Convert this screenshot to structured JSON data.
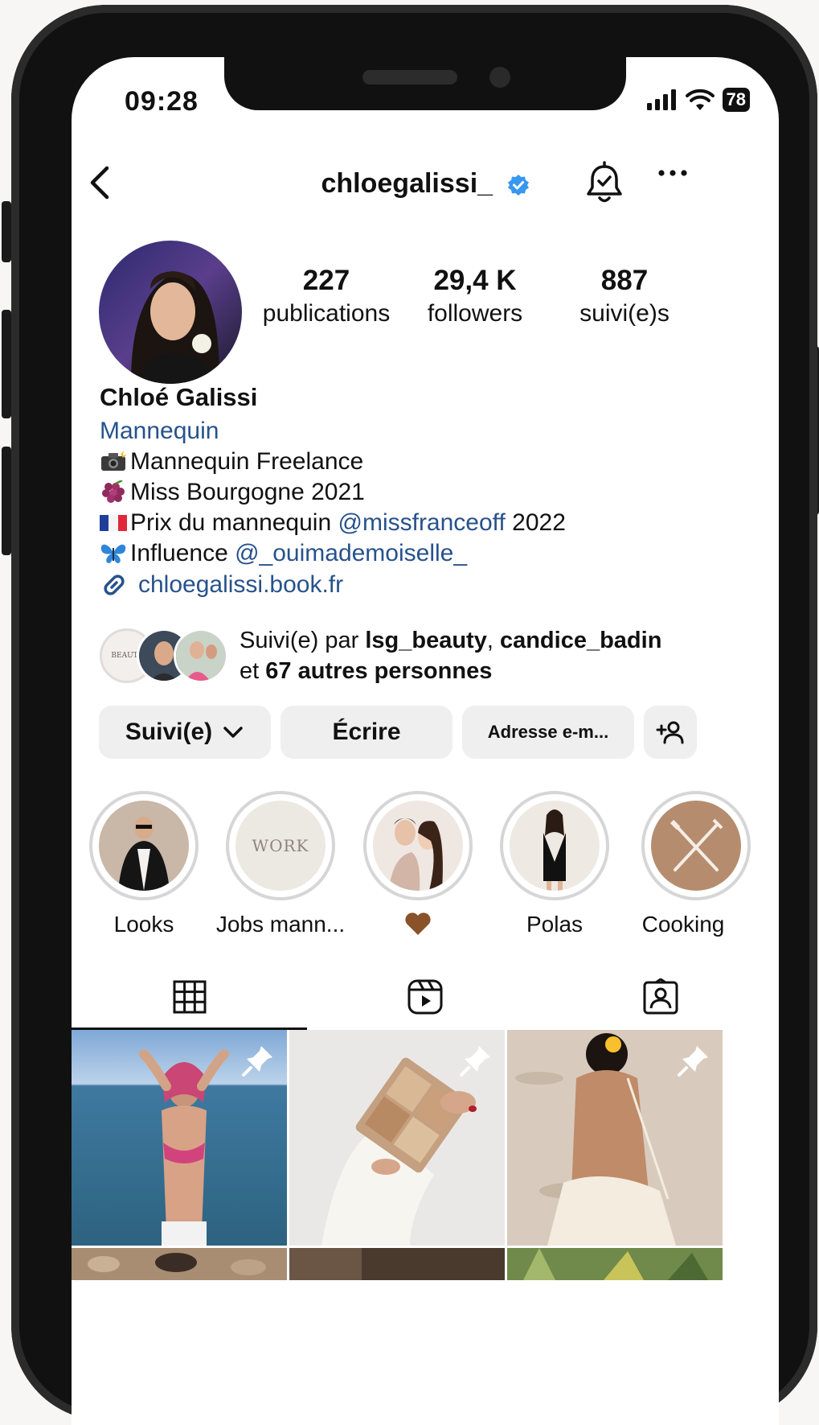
{
  "status_bar": {
    "time": "09:28",
    "battery": "78"
  },
  "header": {
    "username": "chloegalissi_"
  },
  "stats": [
    {
      "number": "227",
      "label": "publications"
    },
    {
      "number": "29,4 K",
      "label": "followers"
    },
    {
      "number": "887",
      "label": "suivi(e)s"
    }
  ],
  "bio": {
    "name": "Chloé Galissi",
    "category": "Mannequin",
    "line1": "Mannequin Freelance",
    "line2": "Miss Bourgogne 2021",
    "line3_prefix": "Prix du mannequin ",
    "line3_mention": "@missfranceoff",
    "line3_suffix": " 2022",
    "line4_prefix": "Influence ",
    "line4_mention": "@_ouimademoiselle_",
    "link": "chloegalissi.book.fr"
  },
  "followed_by": {
    "prefix": "Suivi(e) par ",
    "user1": "lsg_beauty",
    "sep": ", ",
    "user2": "candice_badin",
    "line2_prefix": "et ",
    "others": "67 autres personnes",
    "avatar1_text": "BEAUTY"
  },
  "buttons": {
    "follow": "Suivi(e)",
    "message": "Écrire",
    "email": "Adresse e-m..."
  },
  "highlights": [
    {
      "label": "Looks"
    },
    {
      "label": "Jobs mann...",
      "cover_text": "WORK"
    },
    {
      "label": "♥"
    },
    {
      "label": "Polas"
    },
    {
      "label": "Cooking"
    }
  ],
  "colors": {
    "link": "#27528c",
    "verified": "#3897f0",
    "button_bg": "#efefef"
  }
}
